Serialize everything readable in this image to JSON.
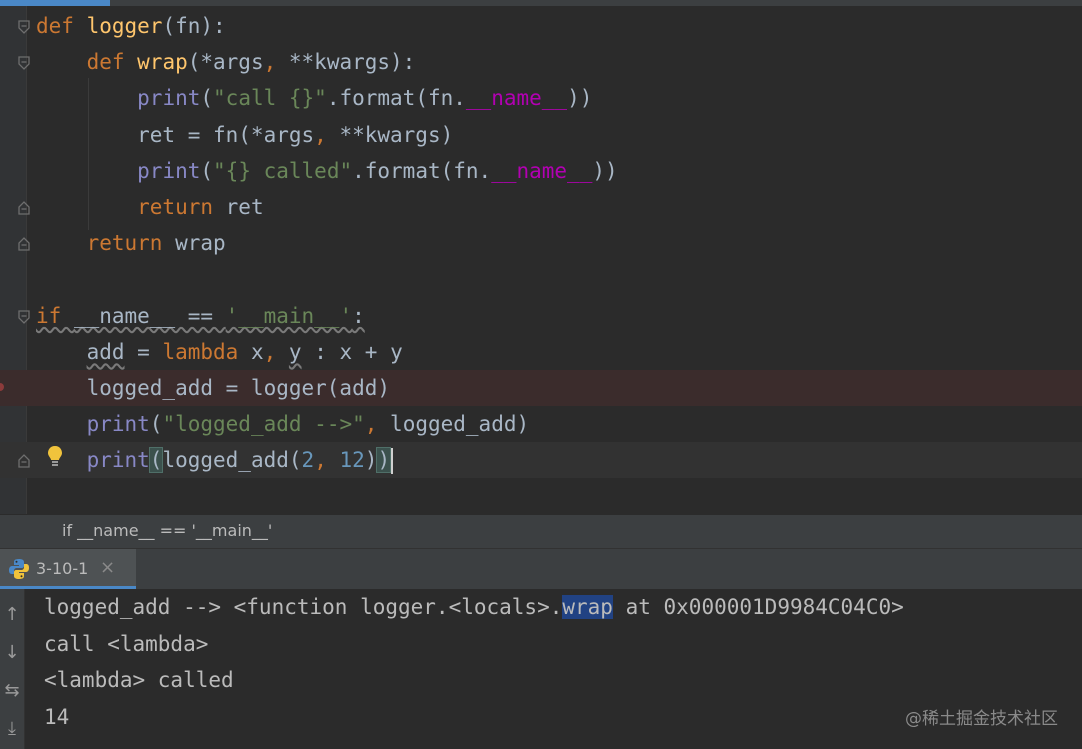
{
  "editor": {
    "lines": [
      {
        "tokens": [
          {
            "t": "def ",
            "c": "kw"
          },
          {
            "t": "logger",
            "c": "fn"
          },
          {
            "t": "(fn):",
            "c": "par"
          }
        ],
        "fold": "open"
      },
      {
        "tokens": [
          {
            "t": "    def ",
            "c": "kw"
          },
          {
            "t": "wrap",
            "c": "fn"
          },
          {
            "t": "(*args",
            "c": "par"
          },
          {
            "t": ", ",
            "c": "kw"
          },
          {
            "t": "**kwargs):",
            "c": "par"
          }
        ],
        "fold": "open"
      },
      {
        "tokens": [
          {
            "t": "        "
          },
          {
            "t": "print",
            "c": "bi"
          },
          {
            "t": "(",
            "c": "par"
          },
          {
            "t": "\"call {}\"",
            "c": "str"
          },
          {
            "t": ".format(fn.",
            "c": "par"
          },
          {
            "t": "__name__",
            "c": "dunder"
          },
          {
            "t": "))",
            "c": "par"
          }
        ]
      },
      {
        "tokens": [
          {
            "t": "        ret = fn(*args",
            "c": "par"
          },
          {
            "t": ", ",
            "c": "kw"
          },
          {
            "t": "**kwargs)",
            "c": "par"
          }
        ]
      },
      {
        "tokens": [
          {
            "t": "        "
          },
          {
            "t": "print",
            "c": "bi"
          },
          {
            "t": "(",
            "c": "par"
          },
          {
            "t": "\"{} called\"",
            "c": "str"
          },
          {
            "t": ".format(fn.",
            "c": "par"
          },
          {
            "t": "__name__",
            "c": "dunder"
          },
          {
            "t": "))",
            "c": "par"
          }
        ]
      },
      {
        "tokens": [
          {
            "t": "        return ",
            "c": "kw"
          },
          {
            "t": "ret",
            "c": "par"
          }
        ],
        "fold": "close"
      },
      {
        "tokens": [
          {
            "t": "    return ",
            "c": "kw"
          },
          {
            "t": "wrap",
            "c": "par"
          }
        ],
        "fold": "close"
      },
      {
        "tokens": []
      },
      {
        "tokens": [
          {
            "t": "if ",
            "c": "kw"
          },
          {
            "t": "__name__ == ",
            "c": "par"
          },
          {
            "t": "'__main__'",
            "c": "str"
          },
          {
            "t": ":",
            "c": "par"
          }
        ],
        "fold": "open",
        "wavy": true
      },
      {
        "tokens": [
          {
            "t": "    "
          },
          {
            "t": "add",
            "c": "par",
            "w": true
          },
          {
            "t": " = ",
            "c": "par"
          },
          {
            "t": "lambda ",
            "c": "kw"
          },
          {
            "t": "x",
            "c": "par"
          },
          {
            "t": ", ",
            "c": "kw"
          },
          {
            "t": "y",
            "c": "par",
            "w": true
          },
          {
            "t": " : x + y",
            "c": "par"
          }
        ]
      },
      {
        "tokens": [
          {
            "t": "    logged_add = logger(add)",
            "c": "par"
          }
        ],
        "breakpoint": true
      },
      {
        "tokens": [
          {
            "t": "    "
          },
          {
            "t": "print",
            "c": "bi"
          },
          {
            "t": "(",
            "c": "par"
          },
          {
            "t": "\"logged_add -->\"",
            "c": "str"
          },
          {
            "t": ", ",
            "c": "kw"
          },
          {
            "t": "logged_add)",
            "c": "par"
          }
        ]
      },
      {
        "tokens": [
          {
            "t": "    "
          },
          {
            "t": "print",
            "c": "bi"
          },
          {
            "t": "(",
            "c": "match"
          },
          {
            "t": "logged_add(",
            "c": "par"
          },
          {
            "t": "2",
            "c": "num"
          },
          {
            "t": ", ",
            "c": "kw"
          },
          {
            "t": "12",
            "c": "num"
          },
          {
            "t": ")",
            "c": "par"
          },
          {
            "t": ")",
            "c": "match"
          }
        ],
        "fold": "close",
        "current": true,
        "bulb": true
      }
    ]
  },
  "breadcrumb": {
    "text": "if __name__ == '__main__'"
  },
  "run": {
    "tab_label": "3-10-1",
    "close_glyph": "×",
    "output": [
      {
        "before": "logged_add --> <function logger.<locals>.",
        "selected": "wrap",
        "after": " at 0x000001D9984C04C0>"
      },
      {
        "before": "call <lambda>",
        "selected": "",
        "after": ""
      },
      {
        "before": "<lambda> called",
        "selected": "",
        "after": ""
      },
      {
        "before": "14",
        "selected": "",
        "after": ""
      }
    ],
    "toolbar_icons": [
      {
        "name": "up-arrow-icon",
        "glyph": "↑"
      },
      {
        "name": "down-arrow-icon",
        "glyph": "↓"
      },
      {
        "name": "soft-wrap-icon",
        "glyph": "⇆"
      },
      {
        "name": "scroll-to-end-icon",
        "glyph": "⤓"
      }
    ]
  },
  "watermark": {
    "text": "@稀土掘金技术社区"
  },
  "colors": {
    "background": "#2b2b2b",
    "keyword": "#cc7832",
    "function": "#ffc66d",
    "builtin": "#8888c6",
    "string": "#6a8759",
    "dunder": "#b200b2",
    "number": "#6897bb",
    "selection": "#214283",
    "breakpoint_line": "#3b2c2c"
  }
}
